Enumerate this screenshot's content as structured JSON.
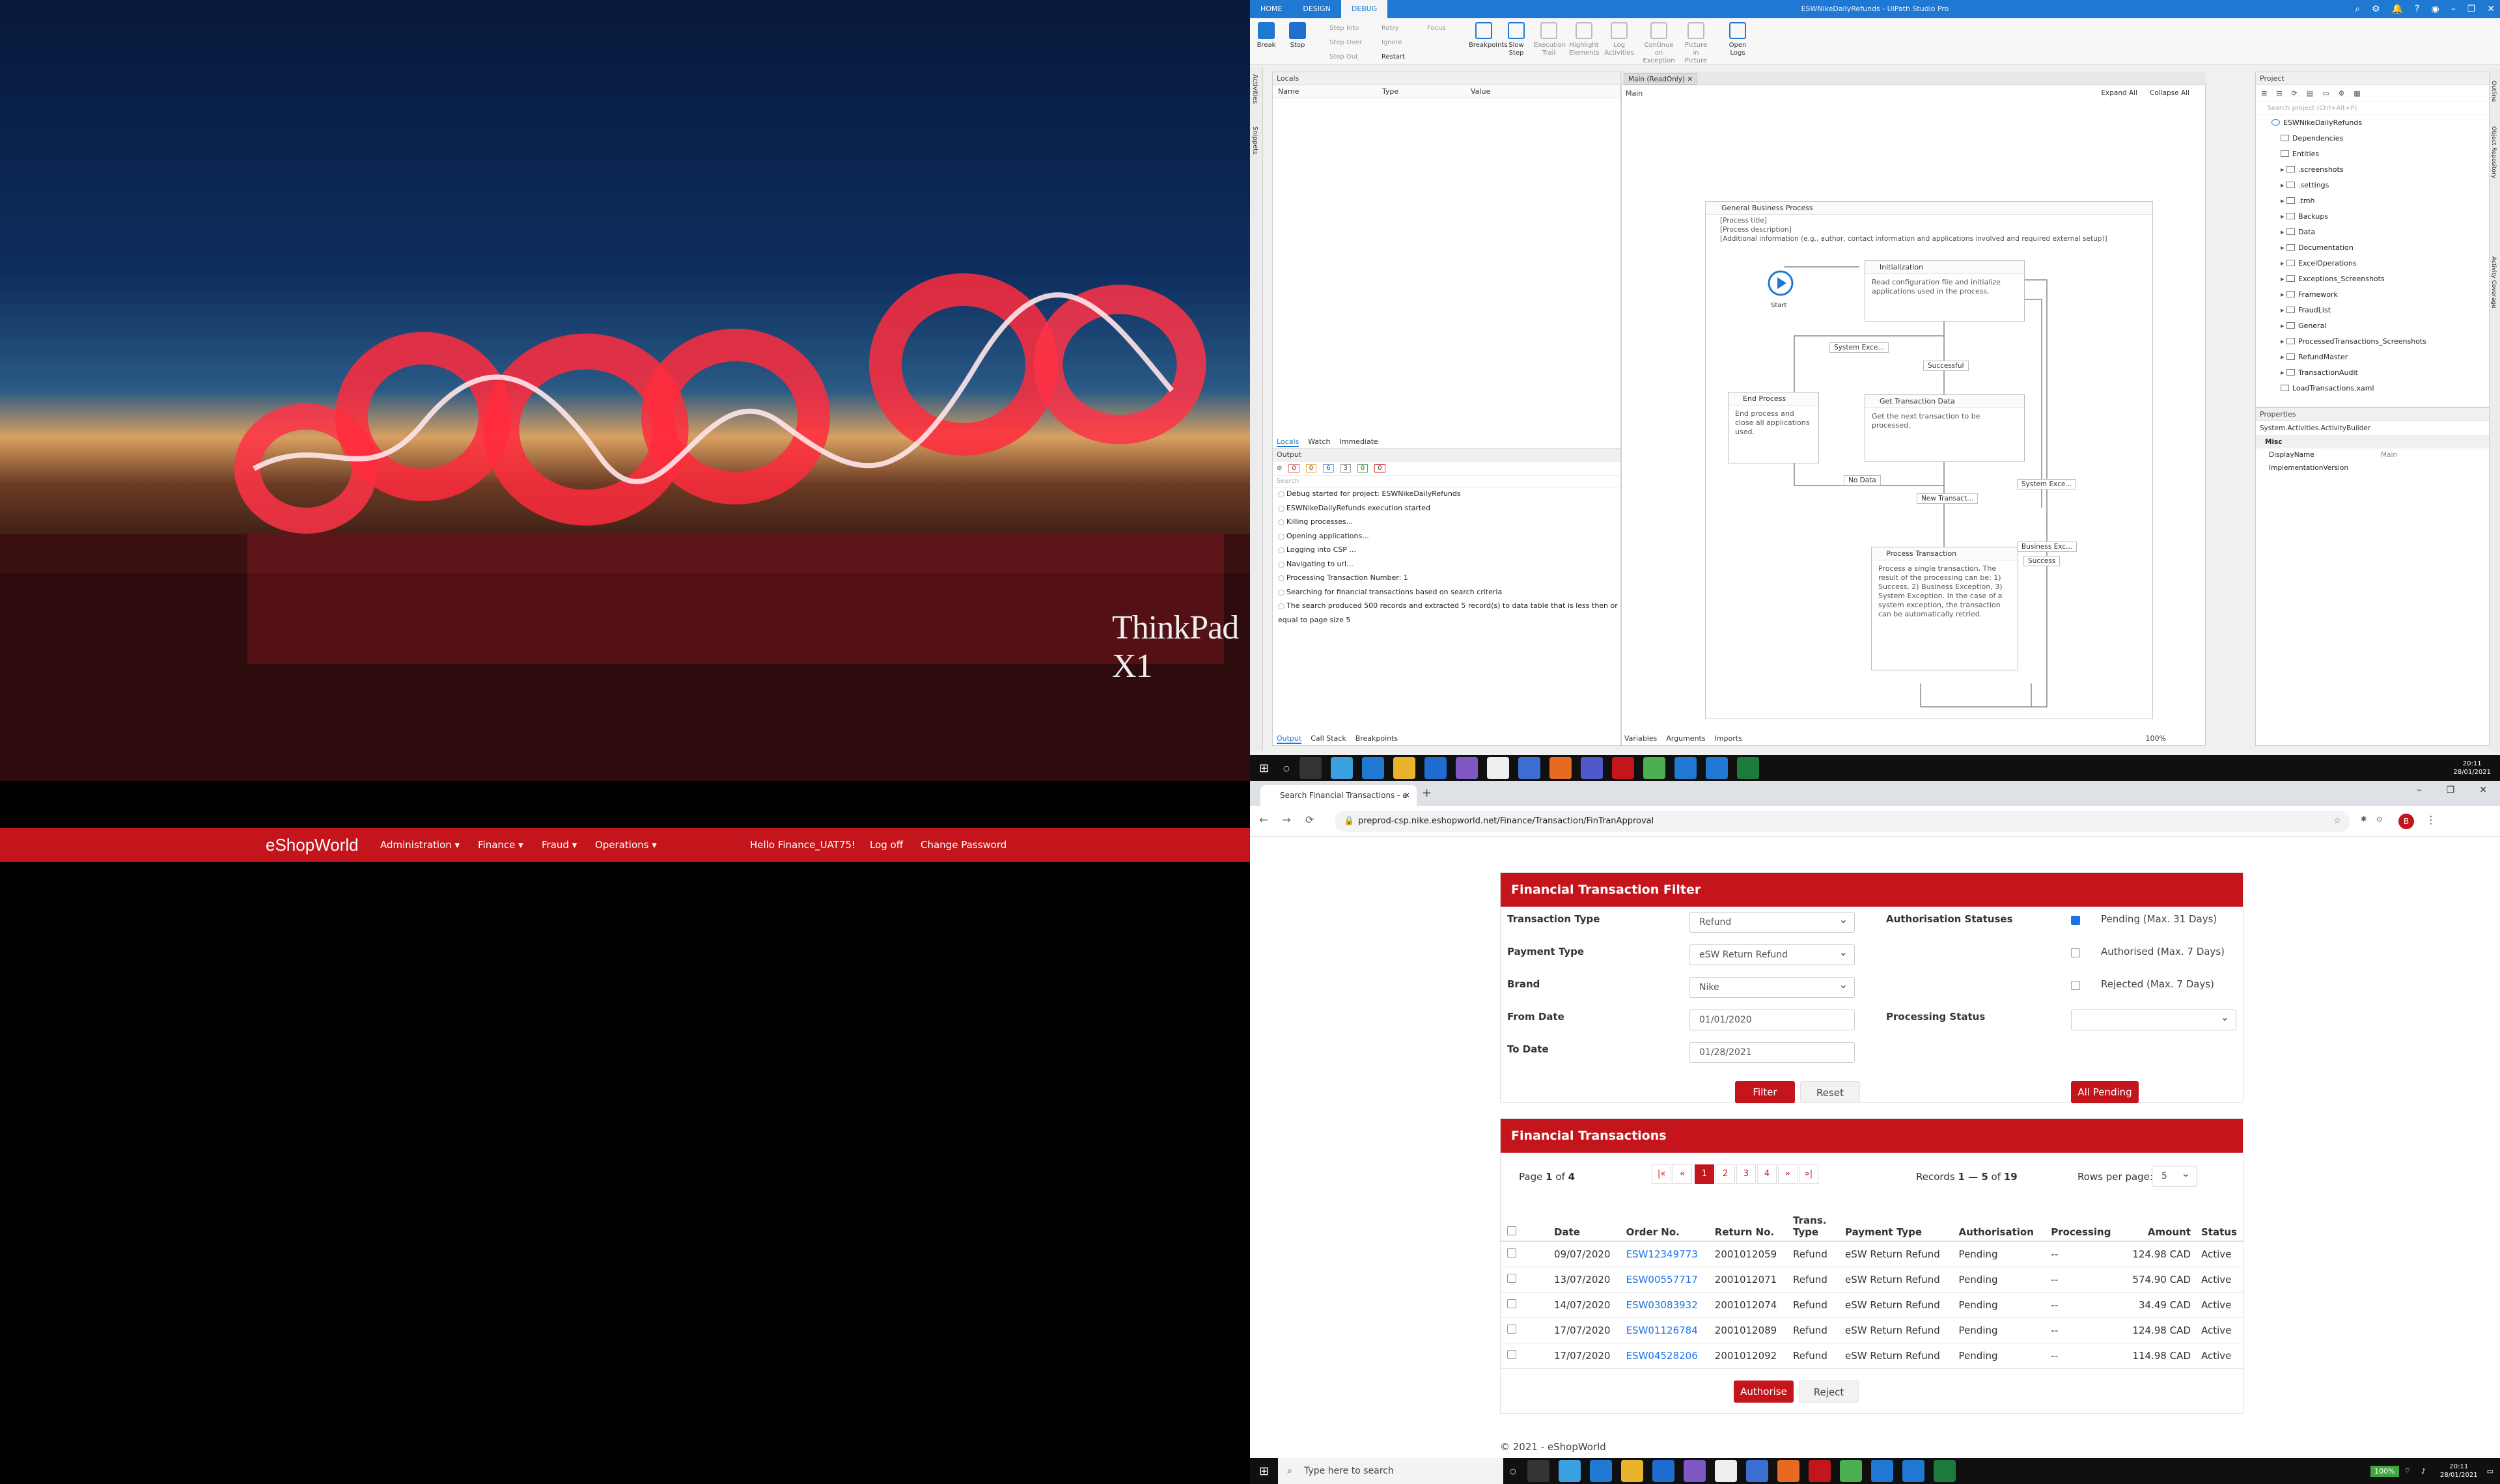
{
  "wallpaper": {
    "brand": "ThinkPad X1"
  },
  "studio": {
    "title": "ESWNikeDailyRefunds - UiPath Studio Pro",
    "tabs": [
      "HOME",
      "DESIGN",
      "DEBUG"
    ],
    "ribbon": {
      "break": "Break",
      "stop": "Stop",
      "step_into": "Step Into",
      "step_over": "Step Over",
      "step_out": "Step Out",
      "retry": "Retry",
      "ignore": "Ignore",
      "restart": "Restart",
      "focus": "Focus",
      "breakpoints": "Breakpoints",
      "slow_step": "Slow Step",
      "execution_trail": "Execution Trail",
      "highlight_elements": "Highlight Elements",
      "log_activities": "Log Activities",
      "continue_on_exception": "Continue on Exception",
      "picture_in_picture": "Picture in Picture",
      "open_logs": "Open Logs"
    },
    "side_tabs": [
      "Activities",
      "Snippets"
    ],
    "right_side_tabs": [
      "Outline",
      "Object Repository",
      "Activity Coverage"
    ],
    "locals": {
      "title": "Locals",
      "columns": [
        "Name",
        "Type",
        "Value"
      ],
      "tabs": [
        "Locals",
        "Watch",
        "Immediate"
      ]
    },
    "output": {
      "title": "Output",
      "filters": [
        "0",
        "0",
        "6",
        "3",
        "0",
        "0"
      ],
      "search_placeholder": "Search",
      "lines": [
        "Debug started for project: ESWNikeDailyRefunds",
        "ESWNikeDailyRefunds execution started",
        "Killing processes...",
        "Opening applications...",
        "Logging into CSP ...",
        "Navigating to url...",
        "Processing Transaction Number: 1",
        "Searching for financial transactions based on search criteria",
        "The search produced 500 records and extracted 5 record(s) to data table that is less then or equal to page size 5"
      ],
      "tabs": [
        "Output",
        "Call Stack",
        "Breakpoints"
      ]
    },
    "designer": {
      "tab": "Main (ReadOnly)",
      "breadcrumb": "Main",
      "expand_all": "Expand All",
      "collapse_all": "Collapse All",
      "flowchart_title": "General Business Process",
      "annotation": [
        "[Process title]",
        "[Process description]",
        "[Additional information (e.g., author, contact information and applications involved and required external setup)]"
      ],
      "start": "Start",
      "nodes": {
        "init_title": "Initialization",
        "init_desc": "Read configuration file and initialize applications used in the process.",
        "get_title": "Get Transaction Data",
        "get_desc": "Get the next transaction to be processed.",
        "end_title": "End Process",
        "end_desc": "End process and close all applications used.",
        "proc_title": "Process Transaction",
        "proc_desc": "Process a single transaction. The result of the processing can be: 1) Success, 2) Business Exception, 3) System Exception. In the case of a system exception, the transaction can be automatically retried."
      },
      "edges": {
        "sys_exc": "System Exce...",
        "successful": "Successful",
        "no_data": "No Data",
        "new_trans": "New Transact...",
        "sys_exc2": "System Exce...",
        "business_exc": "Business Exc...",
        "success": "Success"
      },
      "bottom_tabs": [
        "Variables",
        "Arguments",
        "Imports"
      ],
      "zoom": "100%"
    },
    "project": {
      "title": "Project",
      "search_placeholder": "Search project (Ctrl+Alt+P)",
      "root": "ESWNikeDailyRefunds",
      "items": [
        "Dependencies",
        "Entities",
        ".screenshots",
        ".settings",
        ".tmh",
        "Backups",
        "Data",
        "Documentation",
        "ExcelOperations",
        "Exceptions_Screenshots",
        "Framework",
        "FraudList",
        "General",
        "ProcessedTransactions_Screenshots",
        "RefundMaster",
        "TransactionAudit",
        "LoadTransactions.xaml"
      ]
    },
    "properties": {
      "title": "Properties",
      "type": "System.Activities.ActivityBuilder",
      "category": "Misc",
      "rows": [
        {
          "name": "DisplayName",
          "value": "Main"
        },
        {
          "name": "ImplementationVersion",
          "value": ""
        }
      ]
    }
  },
  "taskbar_top": {
    "time": "20:11",
    "date": "28/01/2021"
  },
  "browser": {
    "tab_title": "Search Financial Transactions - e",
    "url": "preprod-csp.nike.eshopworld.net/Finance/Transaction/FinTranApproval",
    "profile_initial": "B"
  },
  "site": {
    "logo": "eShopWorld",
    "menu": [
      "Administration ▾",
      "Finance ▾",
      "Fraud ▾",
      "Operations ▾"
    ],
    "greeting": "Hello Finance_UAT75!",
    "logoff": "Log off",
    "change_password": "Change Password",
    "filter": {
      "title": "Financial Transaction Filter",
      "transaction_type_label": "Transaction Type",
      "transaction_type": "Refund",
      "payment_type_label": "Payment Type",
      "payment_type": "eSW Return Refund",
      "brand_label": "Brand",
      "brand": "Nike",
      "from_date_label": "From Date",
      "from_date": "01/01/2020",
      "to_date_label": "To Date",
      "to_date": "01/28/2021",
      "auth_status_label": "Authorisation Statuses",
      "statuses": [
        {
          "label": "Pending (Max. 31 Days)",
          "checked": true
        },
        {
          "label": "Authorised (Max. 7 Days)",
          "checked": false
        },
        {
          "label": "Rejected (Max. 7 Days)",
          "checked": false
        }
      ],
      "processing_status_label": "Processing Status",
      "processing_status": "",
      "filter_btn": "Filter",
      "reset_btn": "Reset",
      "all_pending_btn": "All Pending"
    },
    "transactions": {
      "title": "Financial Transactions",
      "page_prefix": "Page",
      "page": "1",
      "page_of": "of",
      "pages": "4",
      "pager": [
        "|«",
        "«",
        "1",
        "2",
        "3",
        "4",
        "»",
        "»|"
      ],
      "records_prefix": "Records",
      "records_range": "1 — 5",
      "records_of": "of",
      "records_total": "19",
      "rows_per_page_label": "Rows per page:",
      "rows_per_page": "5",
      "columns": [
        "Date",
        "Order No.",
        "Return No.",
        "Trans. Type",
        "Payment Type",
        "Authorisation",
        "Processing",
        "Amount",
        "Status"
      ],
      "rows": [
        {
          "date": "09/07/2020",
          "order": "ESW12349773",
          "return": "2001012059",
          "type": "Refund",
          "payment": "eSW Return Refund",
          "auth": "Pending",
          "proc": "--",
          "amount": "124.98 CAD",
          "status": "Active"
        },
        {
          "date": "13/07/2020",
          "order": "ESW00557717",
          "return": "2001012071",
          "type": "Refund",
          "payment": "eSW Return Refund",
          "auth": "Pending",
          "proc": "--",
          "amount": "574.90 CAD",
          "status": "Active"
        },
        {
          "date": "14/07/2020",
          "order": "ESW03083932",
          "return": "2001012074",
          "type": "Refund",
          "payment": "eSW Return Refund",
          "auth": "Pending",
          "proc": "--",
          "amount": "34.49 CAD",
          "status": "Active"
        },
        {
          "date": "17/07/2020",
          "order": "ESW01126784",
          "return": "2001012089",
          "type": "Refund",
          "payment": "eSW Return Refund",
          "auth": "Pending",
          "proc": "--",
          "amount": "124.98 CAD",
          "status": "Active"
        },
        {
          "date": "17/07/2020",
          "order": "ESW04528206",
          "return": "2001012092",
          "type": "Refund",
          "payment": "eSW Return Refund",
          "auth": "Pending",
          "proc": "--",
          "amount": "114.98 CAD",
          "status": "Active"
        }
      ],
      "authorise_btn": "Authorise",
      "reject_btn": "Reject"
    },
    "footer": "© 2021 - eShopWorld"
  },
  "taskbar_bottom": {
    "search_placeholder": "Type here to search",
    "battery": "100%",
    "time": "20:11",
    "date": "28/01/2021"
  }
}
